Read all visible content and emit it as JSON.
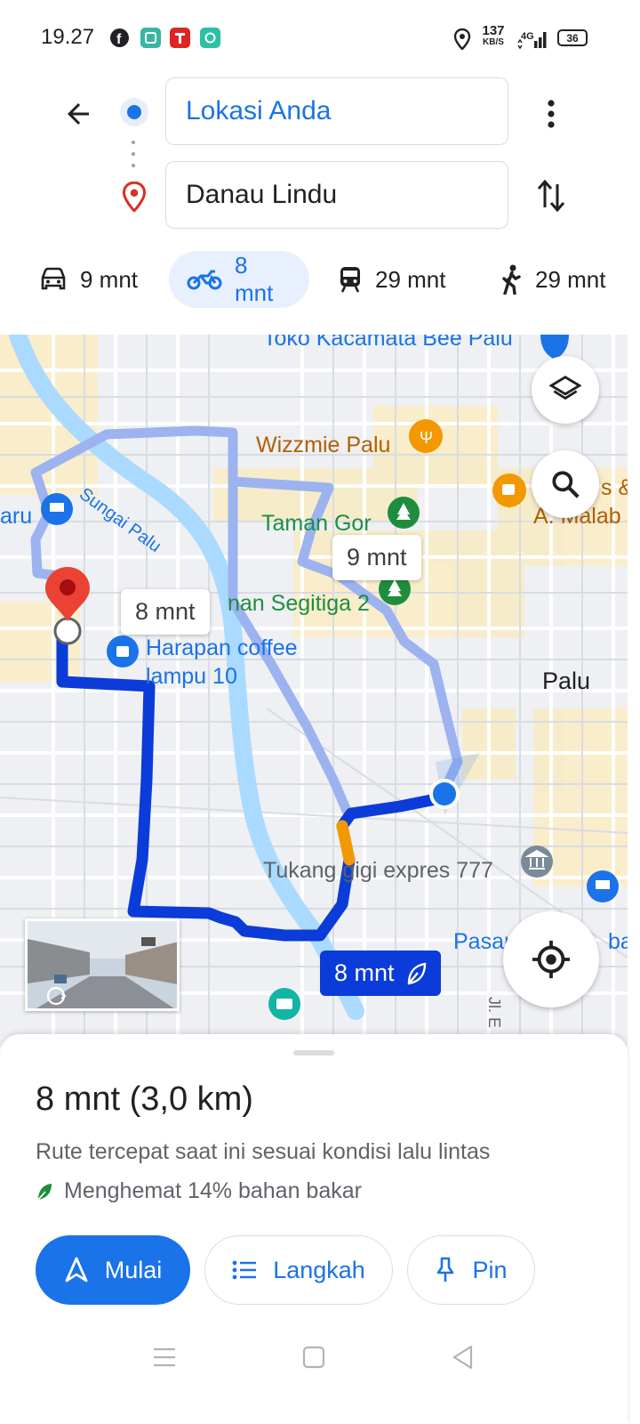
{
  "status_bar": {
    "time": "19.27",
    "net_speed_value": "137",
    "net_speed_unit": "KB/S",
    "network": "4G",
    "battery": "36",
    "notification_icons": [
      "facebook-icon",
      "app-icon-teal",
      "app-icon-red",
      "app-icon-green"
    ]
  },
  "directions": {
    "origin": "Lokasi Anda",
    "destination": "Danau Lindu"
  },
  "modes": [
    {
      "name": "car",
      "time": "9 mnt",
      "icon": "car-icon"
    },
    {
      "name": "motorcycle",
      "time": "8 mnt",
      "icon": "motorcycle-icon",
      "active": true
    },
    {
      "name": "transit",
      "time": "29 mnt",
      "icon": "train-icon"
    },
    {
      "name": "walk",
      "time": "29 mnt",
      "icon": "walking-icon"
    }
  ],
  "map": {
    "labels": {
      "toko": "Toko Kacamata Bee Palu",
      "wizzmie": "Wizzmie Palu",
      "sungai": "Sungai Palu",
      "taman_gor": "Taman Gor",
      "taman_segitiga": "nan Segitiga 2",
      "harapan_1": "Harapan coffee",
      "harapan_2": "lampu 10",
      "palu": "Palu",
      "tukang": "Tukang gigi expres 777",
      "pasar": "Pasar",
      "pasar_suffix": "ba",
      "cafe_1": "s &",
      "cafe_2": "A. Malab",
      "aru": "aru",
      "jl": "Jl. E"
    },
    "route_callouts": {
      "alt_route": "9 mnt",
      "left_route": "8 mnt",
      "main_route": "8 mnt"
    },
    "colors": {
      "route_main": "#0b3bd8",
      "route_alt": "#9cb3f0",
      "traffic": "#f29900",
      "river": "#aadaff"
    }
  },
  "sheet": {
    "summary": "8 mnt (3,0 km)",
    "description": "Rute tercepat saat ini sesuai kondisi lalu lintas",
    "fuel": "Menghemat 14% bahan bakar",
    "buttons": {
      "start": "Mulai",
      "steps": "Langkah",
      "pin": "Pin"
    }
  }
}
